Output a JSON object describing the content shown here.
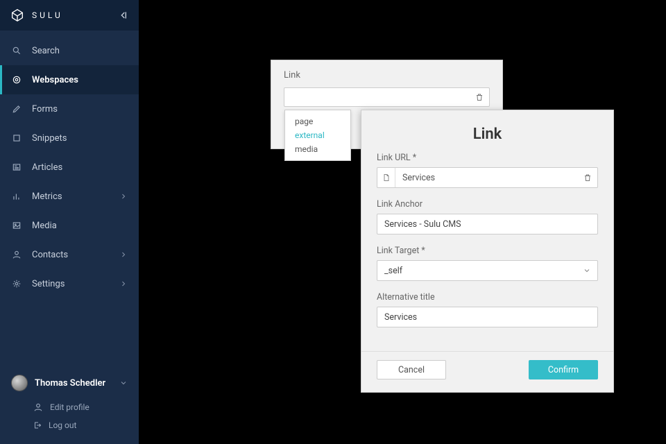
{
  "brand": {
    "name": "SULU"
  },
  "nav": [
    {
      "key": "search",
      "label": "Search",
      "icon": "search",
      "expandable": false,
      "active": false
    },
    {
      "key": "webspaces",
      "label": "Webspaces",
      "icon": "target",
      "expandable": false,
      "active": true
    },
    {
      "key": "forms",
      "label": "Forms",
      "icon": "pencil",
      "expandable": false,
      "active": false
    },
    {
      "key": "snippets",
      "label": "Snippets",
      "icon": "square",
      "expandable": false,
      "active": false
    },
    {
      "key": "articles",
      "label": "Articles",
      "icon": "news",
      "expandable": false,
      "active": false
    },
    {
      "key": "metrics",
      "label": "Metrics",
      "icon": "bars",
      "expandable": true,
      "active": false
    },
    {
      "key": "media",
      "label": "Media",
      "icon": "image",
      "expandable": false,
      "active": false
    },
    {
      "key": "contacts",
      "label": "Contacts",
      "icon": "user",
      "expandable": true,
      "active": false
    },
    {
      "key": "settings",
      "label": "Settings",
      "icon": "gear",
      "expandable": true,
      "active": false
    }
  ],
  "user": {
    "name": "Thomas Schedler",
    "menu": [
      {
        "key": "edit-profile",
        "label": "Edit profile",
        "icon": "user"
      },
      {
        "key": "log-out",
        "label": "Log out",
        "icon": "logout"
      }
    ]
  },
  "small_panel": {
    "title": "Link",
    "dropdown": {
      "options": [
        "page",
        "external",
        "media"
      ],
      "selected": "external"
    }
  },
  "modal": {
    "title": "Link",
    "fields": {
      "url": {
        "label": "Link URL *",
        "value": "Services"
      },
      "anchor": {
        "label": "Link Anchor",
        "value": "Services - Sulu CMS"
      },
      "target": {
        "label": "Link Target *",
        "value": "_self"
      },
      "alt": {
        "label": "Alternative title",
        "value": "Services"
      }
    },
    "buttons": {
      "cancel": "Cancel",
      "confirm": "Confirm"
    }
  }
}
